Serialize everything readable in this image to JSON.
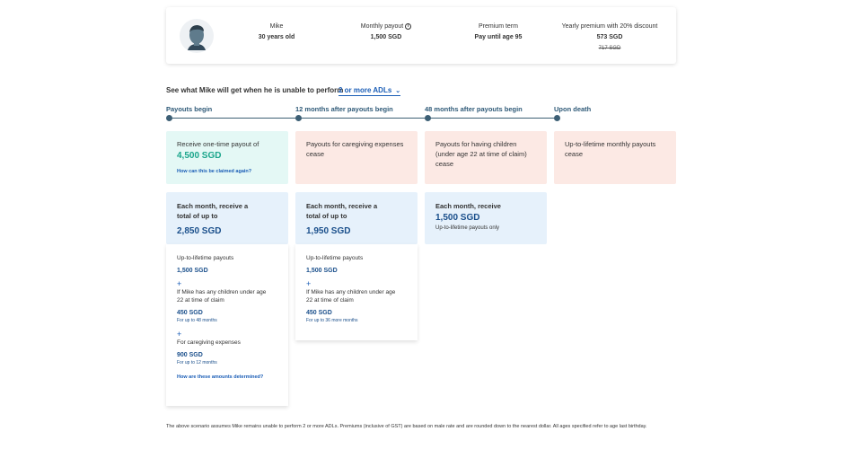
{
  "profile": {
    "name": "Mike",
    "age": "30 years old",
    "monthly_payout_label": "Monthly payout",
    "monthly_payout_value": "1,500 SGD",
    "premium_term_label": "Premium term",
    "premium_term_value": "Pay until age 95",
    "yearly_premium_label": "Yearly premium with 20% discount",
    "yearly_premium_value": "573 SGD",
    "yearly_premium_original": "717 SGD",
    "info_icon": "i"
  },
  "question": {
    "text": "See what Mike will get when he is unable to perform",
    "selected_option": "2 or more ADLs",
    "chevron": "⌄"
  },
  "timeline": [
    "Payouts begin",
    "12 months after payouts begin",
    "48 months after payouts begin",
    "Upon death"
  ],
  "stage_boxes": {
    "one_time": {
      "text": "Receive one-time payout of",
      "amount": "4,500 SGD",
      "link": "How can this be claimed again?"
    },
    "caregiving_cease": "Payouts for caregiving expenses cease",
    "children_cease": "Payouts for having children (under age 22 at time of claim) cease",
    "lifetime_cease": "Up-to-lifetime monthly payouts cease"
  },
  "monthly_boxes": [
    {
      "text": "Each month, receive a total of up to",
      "amount": "2,850 SGD"
    },
    {
      "text": "Each month, receive a total of up to",
      "amount": "1,950 SGD"
    },
    {
      "text": "Each month, receive",
      "amount": "1,500 SGD",
      "note": "Up-to-lifetime payouts only"
    }
  ],
  "details": [
    {
      "lifetime_label": "Up-to-lifetime payouts",
      "lifetime_amount": "1,500 SGD",
      "plus": "+",
      "children_label": "If Mike has any children under age 22 at time of claim",
      "children_amount": "450 SGD",
      "children_duration": "For up to 48 months",
      "plus2": "+",
      "caregiving_label": "For caregiving expenses",
      "caregiving_amount": "900 SGD",
      "caregiving_duration": "For up to 12 months",
      "link": "How are these amounts determined?"
    },
    {
      "lifetime_label": "Up-to-lifetime payouts",
      "lifetime_amount": "1,500 SGD",
      "plus": "+",
      "children_label": "If Mike has any children under age 22 at time of claim",
      "children_amount": "450 SGD",
      "children_duration": "For up to 36 more months"
    }
  ],
  "footnote": "The above scenario assumes Mike remains unable to perform 2 or more ADLs. Premiums (inclusive of GST) are based on male rate and are rounded down to the nearest dollar. All ages specified refer to age last birthday.",
  "colors": {
    "accent_blue": "#1a5db6",
    "green_amount": "#1aa58b",
    "timeline": "#3d5f75",
    "green_bg": "#e4f8f5",
    "salmon_bg": "#fce9e4",
    "blue_bg": "#e6f1fb"
  }
}
